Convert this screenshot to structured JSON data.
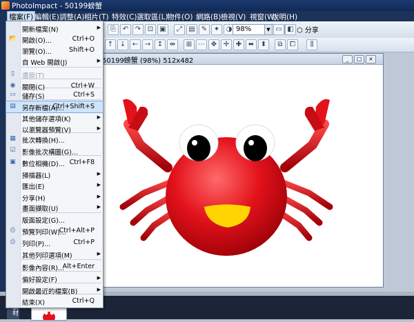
{
  "window": {
    "title": "PhotoImpact - 50199螃蟹"
  },
  "menubar": {
    "items": [
      "檔案(F)",
      "編輯(E)",
      "調整(A)",
      "相片(T)",
      "特效(C)",
      "選取區(L)",
      "物件(O)",
      "網路(B)",
      "檢視(V)",
      "視窗(W)",
      "說明(H)"
    ]
  },
  "toolbar": {
    "zoom_value": "98%",
    "share_label": "分享"
  },
  "image_window": {
    "title": "50199螃蟹 (98%) 512x482"
  },
  "filmstrip": {
    "tab_label": "素材"
  },
  "file_menu": {
    "items": [
      {
        "label": "開新檔案(N)",
        "shortcut": "",
        "submenu": true,
        "icon": "new-file-icon",
        "disabled": false
      },
      {
        "label": "開啟(O)...",
        "shortcut": "Ctrl+O",
        "submenu": false,
        "icon": "open-folder-icon",
        "disabled": false
      },
      {
        "label": "瀏覽(O)...",
        "shortcut": "Shift+O",
        "submenu": false,
        "icon": "",
        "disabled": false
      },
      {
        "label": "自 Web 開啟(J)",
        "shortcut": "",
        "submenu": true,
        "icon": "",
        "disabled": false
      },
      {
        "label": "還原(T)",
        "shortcut": "",
        "submenu": false,
        "icon": "revert-icon",
        "disabled": true
      },
      {
        "label": "關閉(C)",
        "shortcut": "Ctrl+W",
        "submenu": false,
        "icon": "close-doc-icon",
        "disabled": false
      },
      {
        "label": "儲存(S)",
        "shortcut": "Ctrl+S",
        "submenu": false,
        "icon": "save-icon",
        "disabled": false
      },
      {
        "label": "另存新檔(A)...",
        "shortcut": "Ctrl+Shift+S",
        "submenu": false,
        "icon": "save-as-icon",
        "disabled": false
      },
      {
        "label": "其他儲存選項(K)",
        "shortcut": "",
        "submenu": true,
        "icon": "",
        "disabled": false
      },
      {
        "label": "以瀏覽器預覽(V)",
        "shortcut": "",
        "submenu": true,
        "icon": "",
        "disabled": false
      },
      {
        "label": "批次轉換(H)...",
        "shortcut": "",
        "submenu": false,
        "icon": "batch-convert-icon",
        "disabled": false
      },
      {
        "label": "影像批次構圖(G)...",
        "shortcut": "",
        "submenu": false,
        "icon": "batch-layout-icon",
        "disabled": false
      },
      {
        "label": "數位相機(D)...",
        "shortcut": "Ctrl+F8",
        "submenu": false,
        "icon": "camera-icon",
        "disabled": false
      },
      {
        "label": "掃描器(L)",
        "shortcut": "",
        "submenu": true,
        "icon": "",
        "disabled": false
      },
      {
        "label": "匯出(E)",
        "shortcut": "",
        "submenu": true,
        "icon": "",
        "disabled": false
      },
      {
        "label": "分享(H)",
        "shortcut": "",
        "submenu": true,
        "icon": "",
        "disabled": false
      },
      {
        "label": "畫面擷取(U)",
        "shortcut": "",
        "submenu": true,
        "icon": "",
        "disabled": false
      },
      {
        "label": "版面設定(G)...",
        "shortcut": "",
        "submenu": false,
        "icon": "",
        "disabled": false
      },
      {
        "label": "預覽列印(W)...",
        "shortcut": "Ctrl+Alt+P",
        "submenu": false,
        "icon": "print-preview-icon",
        "disabled": false
      },
      {
        "label": "列印(P)...",
        "shortcut": "Ctrl+P",
        "submenu": false,
        "icon": "print-icon",
        "disabled": false
      },
      {
        "label": "其他列印選項(M)",
        "shortcut": "",
        "submenu": true,
        "icon": "",
        "disabled": false
      },
      {
        "label": "影像內容(R)...",
        "shortcut": "Alt+Enter",
        "submenu": false,
        "icon": "",
        "disabled": false
      },
      {
        "label": "偏好設定(F)",
        "shortcut": "",
        "submenu": true,
        "icon": "",
        "disabled": false
      },
      {
        "label": "開啟最近的檔案(B)",
        "shortcut": "",
        "submenu": true,
        "icon": "",
        "disabled": false
      },
      {
        "label": "結束(X)",
        "shortcut": "Ctrl+Q",
        "submenu": false,
        "icon": "",
        "disabled": false
      }
    ],
    "highlighted_label": "另存新檔(A)..."
  },
  "colors": {
    "menubar_bg": "#1c3258",
    "highlight": "#cfe3fa",
    "crab_red": "#e3121b",
    "mouth_yellow": "#ffd400"
  }
}
